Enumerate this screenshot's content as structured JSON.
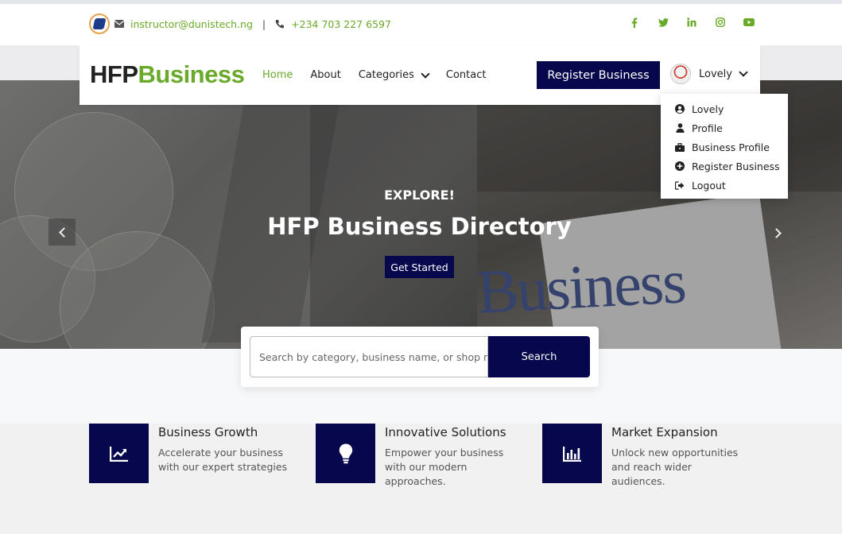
{
  "topbar": {
    "email": "instructor@dunistech.ng",
    "separator": "|",
    "phone": "+234 703 227 6597",
    "social_icons": [
      "facebook-icon",
      "twitter-icon",
      "linkedin-icon",
      "instagram-icon",
      "youtube-icon"
    ]
  },
  "brand": {
    "part1": "HFP",
    "part2": "Business"
  },
  "nav": {
    "home": "Home",
    "about": "About",
    "categories": "Categories",
    "contact": "Contact"
  },
  "register_button": "Register Business",
  "user": {
    "name": "Lovely"
  },
  "dropdown": {
    "items": [
      {
        "label": "Lovely",
        "icon": "user-circle-icon"
      },
      {
        "label": "Profile",
        "icon": "user-icon"
      },
      {
        "label": "Business Profile",
        "icon": "briefcase-icon"
      },
      {
        "label": "Register Business",
        "icon": "plus-circle-icon"
      },
      {
        "label": "Logout",
        "icon": "logout-icon"
      }
    ]
  },
  "hero": {
    "kicker": "EXPLORE!",
    "title": "HFP Business Directory",
    "cta": "Get Started",
    "image_word": "Business"
  },
  "search": {
    "placeholder": "Search by category, business name, or shop number",
    "button": "Search"
  },
  "features": [
    {
      "title": "Business Growth",
      "desc": "Accelerate your business with our expert strategies",
      "icon": "trending-up-icon"
    },
    {
      "title": "Innovative Solutions",
      "desc": "Empower your business with our modern approaches.",
      "icon": "lightbulb-icon"
    },
    {
      "title": "Market Expansion",
      "desc": "Unlock new opportunities and reach wider audiences.",
      "icon": "bar-chart-icon"
    }
  ],
  "colors": {
    "primary": "#07074d",
    "accent": "#6aaa2a"
  }
}
